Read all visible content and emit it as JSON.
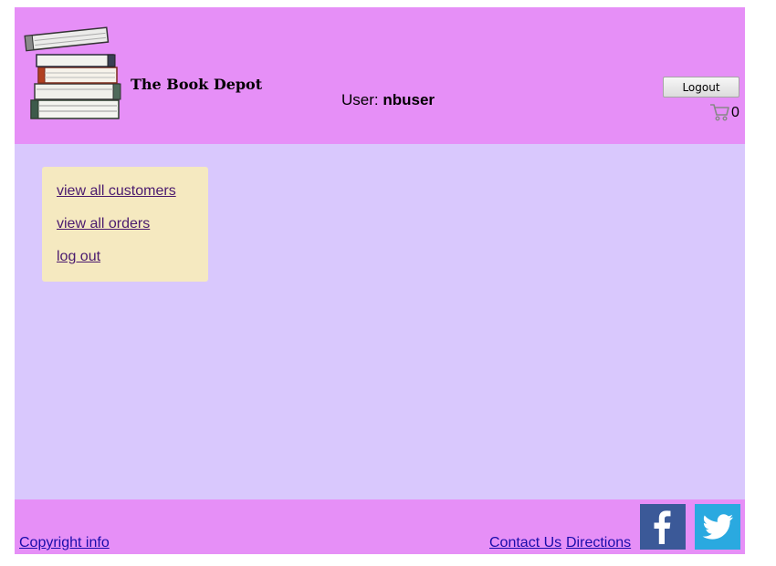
{
  "header": {
    "site_title": "The Book Depot",
    "user_label": "User:",
    "username": "nbuser",
    "logout_label": "Logout",
    "cart_count": "0",
    "logo_icon": "book-stack-icon",
    "cart_icon": "shopping-cart-icon"
  },
  "menu": {
    "items": [
      {
        "label": "view all customers"
      },
      {
        "label": "view all orders"
      },
      {
        "label": "log out"
      }
    ]
  },
  "footer": {
    "copyright": "Copyright info",
    "contact": "Contact Us",
    "directions": "Directions",
    "facebook_icon": "facebook-icon",
    "twitter_icon": "twitter-icon"
  },
  "colors": {
    "header_bg": "#e68ff7",
    "main_bg": "#d9c8fd",
    "menu_bg": "#f5e9c0",
    "facebook": "#3b5998",
    "twitter": "#2aa9e0"
  }
}
